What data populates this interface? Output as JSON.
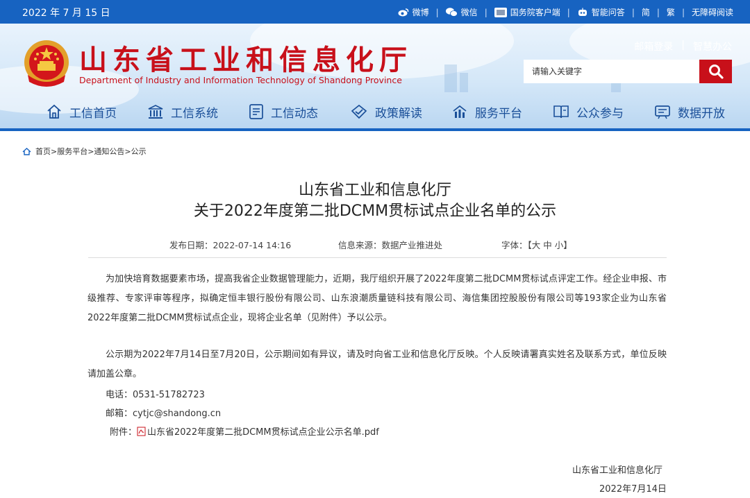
{
  "topbar": {
    "date": "2022 年 7 月 15 日",
    "links": [
      {
        "label": "微博",
        "icon": "weibo-icon"
      },
      {
        "label": "微信",
        "icon": "wechat-icon"
      },
      {
        "label": "国务院客户端",
        "icon": "state-council-app-icon"
      },
      {
        "label": "智能问答",
        "icon": "robot-icon"
      },
      {
        "label": "简"
      },
      {
        "label": "繁"
      },
      {
        "label": "无障碍阅读"
      }
    ]
  },
  "header": {
    "title": "山东省工业和信息化厅",
    "subtitle": "Department of Industry and Information Technology of Shandong Province",
    "user_links": [
      "邮箱登录",
      "智慧办公"
    ],
    "search": {
      "placeholder": "请输入关键字"
    },
    "brand_color": "#c8101a",
    "accent_color": "#1763c1"
  },
  "nav": [
    {
      "label": "工信首页",
      "icon": "home-icon"
    },
    {
      "label": "工信系统",
      "icon": "institution-icon"
    },
    {
      "label": "工信动态",
      "icon": "news-icon"
    },
    {
      "label": "政策解读",
      "icon": "policy-icon"
    },
    {
      "label": "服务平台",
      "icon": "service-icon"
    },
    {
      "label": "公众参与",
      "icon": "book-icon"
    },
    {
      "label": "数据开放",
      "icon": "data-icon"
    }
  ],
  "breadcrumb": "首页>服务平台>通知公告>公示",
  "article": {
    "title_line1": "山东省工业和信息化厅",
    "title_line2": "关于2022年度第二批DCMM贯标试点企业名单的公示",
    "publish": "发布日期：2022-07-14 14:16",
    "source": "信息来源：数据产业推进处",
    "fontsize": "字体：【大 中 小】",
    "para1": "为加快培育数据要素市场，提高我省企业数据管理能力，近期，我厅组织开展了2022年度第二批DCMM贯标试点评定工作。经企业申报、市级推荐、专家评审等程序，拟确定恒丰银行股份有限公司、山东浪潮质量链科技有限公司、海信集团控股股份有限公司等193家企业为山东省2022年度第二批DCMM贯标试点企业，现将企业名单（见附件）予以公示。",
    "para2": "公示期为2022年7月14日至7月20日，公示期间如有异议，请及时向省工业和信息化厅反映。个人反映请署真实姓名及联系方式，单位反映请加盖公章。",
    "phone": "电话：0531-51782723",
    "email": "邮箱：cytjc@shandong.cn",
    "attachment_label": "附件：",
    "attachment_file": "山东省2022年度第二批DCMM贯标试点企业公示名单.pdf",
    "signature": "山东省工业和信息化厅",
    "sign_date": "2022年7月14日"
  }
}
